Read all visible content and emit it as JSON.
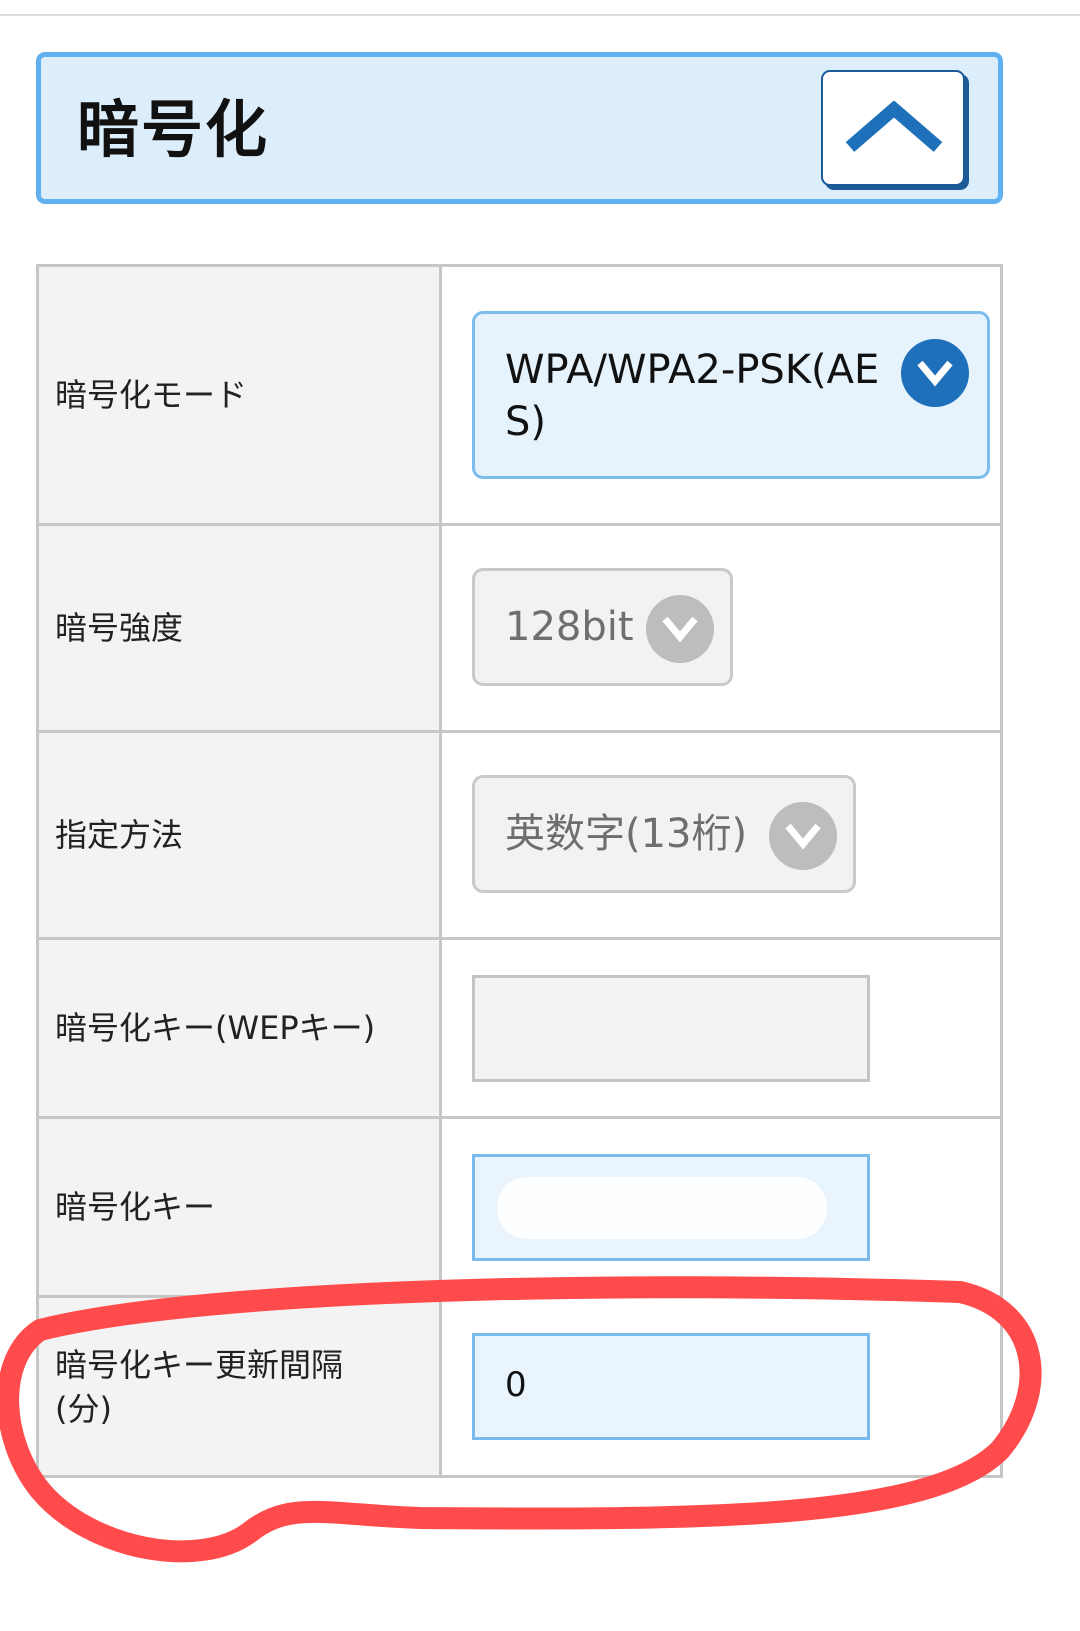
{
  "section": {
    "title": "暗号化",
    "collapse_icon": "chevron-up-icon"
  },
  "rows": [
    {
      "label": "暗号化モード",
      "value": "WPA/WPA2-PSK(AES)",
      "value_line1": "WPA/WPA2-PSK(AE",
      "value_line2": "S)",
      "type": "select",
      "state": "active"
    },
    {
      "label": "暗号強度",
      "value": "128bit",
      "type": "select",
      "state": "disabled"
    },
    {
      "label": "指定方法",
      "value": "英数字(13桁)",
      "type": "select",
      "state": "disabled"
    },
    {
      "label": "暗号化キー(WEPキー)",
      "value": "",
      "type": "input",
      "state": "disabled"
    },
    {
      "label": "暗号化キー",
      "value": "",
      "type": "input",
      "state": "active",
      "redacted": true
    },
    {
      "label": "暗号化キー更新間隔(分)",
      "label_line1": "暗号化キー更新間隔",
      "label_line2": "(分)",
      "value": "0",
      "type": "input",
      "state": "active"
    }
  ],
  "colors": {
    "header_bg": "#dceefc",
    "header_border": "#61b1f0",
    "accent_blue": "#1f70ba",
    "annotation_red": "#ff4b4b"
  },
  "icons": {
    "dropdown_active": "chevron-down-circle-icon",
    "dropdown_disabled": "chevron-down-circle-icon"
  }
}
